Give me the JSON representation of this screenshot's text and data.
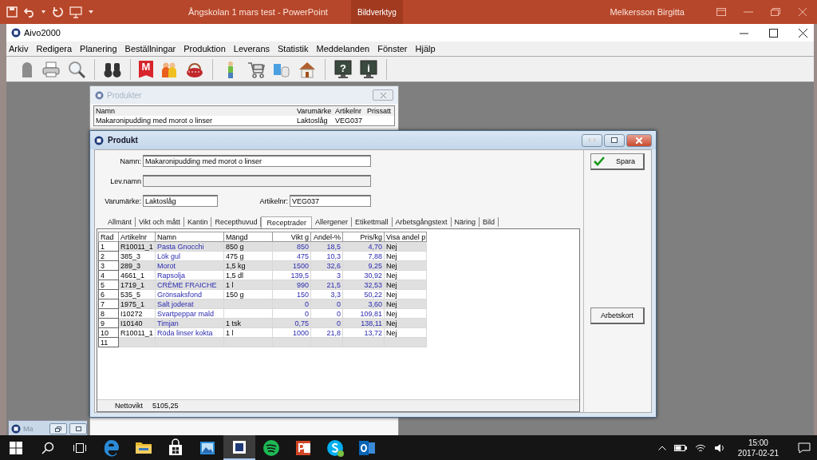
{
  "powerpoint": {
    "title": "Ångskolan 1 mars test  -  PowerPoint",
    "context_tab": "Bildverktyg",
    "user": "Melkersson Birgitta"
  },
  "app": {
    "title": "Aivo2000",
    "menu": [
      "Arkiv",
      "Redigera",
      "Planering",
      "Beställningar",
      "Produktion",
      "Leverans",
      "Statistik",
      "Meddelanden",
      "Fönster",
      "Hjälp"
    ],
    "toolbar": [
      [
        {
          "kind": "silhouette"
        },
        {
          "kind": "printer"
        },
        {
          "kind": "magnifier"
        }
      ],
      [
        {
          "kind": "binoculars"
        }
      ],
      [
        {
          "kind": "letter",
          "glyph": "M"
        },
        {
          "kind": "people"
        },
        {
          "kind": "basket"
        }
      ],
      [
        {
          "kind": "figure"
        },
        {
          "kind": "trolley"
        },
        {
          "kind": "cups"
        },
        {
          "kind": "house"
        }
      ],
      [
        {
          "kind": "monitor",
          "glyph": "?"
        },
        {
          "kind": "monitor",
          "glyph": "i"
        }
      ]
    ]
  },
  "products_window": {
    "title": "Produkter",
    "columns": [
      "Namn",
      "Varumärke",
      "Artikelnr",
      "Prissatt"
    ],
    "rows": [
      [
        "Makaronipudding med morot o linser",
        "Laktoslåg",
        "VEG037"
      ]
    ]
  },
  "product_window": {
    "title": "Produkt",
    "fields": [
      {
        "label": "Namn:",
        "value": "Makaronipudding med morot o linser",
        "disabled": false
      },
      {
        "label": "Lev.namn",
        "disabled": true
      },
      {
        "label": "Varumärke:",
        "value": "Laktoslåg",
        "disabled": false
      },
      {
        "label": "Artikelnr:",
        "value": "VEG037",
        "disabled": false
      }
    ],
    "tabs": [
      {
        "label": "Allmänt",
        "selected": false
      },
      {
        "label": "Vikt och mått",
        "selected": false
      },
      {
        "label": "Kantin",
        "selected": false
      },
      {
        "label": "Recepthuvud",
        "selected": false
      },
      {
        "label": "Receptrader",
        "selected": true
      },
      {
        "label": "Allergener",
        "selected": false
      },
      {
        "label": "Etikettmall",
        "selected": false
      },
      {
        "label": "Arbetsgångstext",
        "selected": false
      },
      {
        "label": "Näring",
        "selected": false
      },
      {
        "label": "Bild",
        "selected": false
      }
    ],
    "table": {
      "columns": [
        "Rad",
        "Artikelnr",
        "Namn",
        "Mängd",
        "Vikt g",
        "Andel-%",
        "Pris/kg",
        "Visa andel p"
      ],
      "rows": [
        [
          "1",
          "R10011_1",
          "Pasta Gnocchi",
          "850 g",
          "850",
          "18,5",
          "4,70",
          "Nej"
        ],
        [
          "2",
          "385_3",
          "Lök gul",
          "475 g",
          "475",
          "10,3",
          "7,88",
          "Nej"
        ],
        [
          "3",
          "289_3",
          "Morot",
          "1,5 kg",
          "1500",
          "32,6",
          "9,25",
          "Nej"
        ],
        [
          "4",
          "4661_1",
          "Rapsolja",
          "1,5 dl",
          "139,5",
          "3",
          "30,92",
          "Nej"
        ],
        [
          "5",
          "1719_1",
          "CRÈME FRAICHE",
          "1 l",
          "990",
          "21,5",
          "32,53",
          "Nej"
        ],
        [
          "6",
          "535_5",
          "Grönsaksfond",
          "150 g",
          "150",
          "3,3",
          "50,22",
          "Nej"
        ],
        [
          "7",
          "1975_1",
          "Salt joderat",
          null,
          "0",
          "0",
          "3,60",
          "Nej"
        ],
        [
          "8",
          "I10272",
          "Svartpeppar mald",
          null,
          "0",
          "0",
          "109,81",
          "Nej"
        ],
        [
          "9",
          "I10140",
          "Timjan",
          "1 tsk",
          "0,75",
          "0",
          "138,11",
          "Nej"
        ],
        [
          "10",
          "R10011_1",
          "Röda linser kokta",
          "1 l",
          "1000",
          "21,8",
          "13,72",
          "Nej"
        ],
        [
          "11"
        ]
      ]
    },
    "net_weight_label": "Nettovikt",
    "net_weight": "5105,25",
    "buttons": [
      "Spara",
      "Arbetskort"
    ]
  },
  "minimized_window": {
    "title": "Ma"
  },
  "taskbar": {
    "apps": [
      {
        "kind": "edge",
        "selected": false
      },
      {
        "kind": "folder",
        "selected": false
      },
      {
        "kind": "store",
        "selected": false
      },
      {
        "kind": "photos",
        "selected": false
      },
      {
        "kind": "aivo",
        "selected": true
      },
      {
        "kind": "spotify",
        "selected": false
      },
      {
        "kind": "powerpoint",
        "selected": false
      },
      {
        "kind": "skype",
        "selected": false
      },
      {
        "kind": "outlook",
        "selected": false
      }
    ],
    "time": "15:00",
    "date": "2017-02-21"
  }
}
